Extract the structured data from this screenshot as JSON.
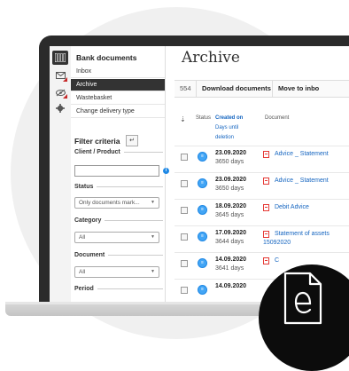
{
  "sidebar": {
    "title": "Bank documents",
    "items": [
      {
        "label": "Inbox",
        "active": false
      },
      {
        "label": "Archive",
        "active": true
      },
      {
        "label": "Wastebasket",
        "active": false
      },
      {
        "label": "Change delivery type",
        "active": false
      }
    ],
    "filter": {
      "title": "Filter criteria",
      "client_label": "Client / Product",
      "client_value": "",
      "status_label": "Status",
      "status_value": "Only documents mark...",
      "category_label": "Category",
      "category_value": "All",
      "document_label": "Document",
      "document_value": "All",
      "period_label": "Period"
    }
  },
  "main": {
    "title": "Archive",
    "toolbar": {
      "count": "554",
      "download_label": "Download documents",
      "move_label": "Move to inbo"
    },
    "columns": {
      "status": "Status",
      "created_on": "Created on",
      "days_line1": "Days until",
      "days_line2": "deletion",
      "document": "Document"
    },
    "rows": [
      {
        "date": "23.09.2020",
        "days": "3650 days",
        "doc": "Advice _ Statement",
        "doc2": ""
      },
      {
        "date": "23.09.2020",
        "days": "3650 days",
        "doc": "Advice _ Statement",
        "doc2": ""
      },
      {
        "date": "18.09.2020",
        "days": "3645 days",
        "doc": "Debit Advice",
        "doc2": ""
      },
      {
        "date": "17.09.2020",
        "days": "3644 days",
        "doc": "Statement of assets",
        "doc2": "15092020"
      },
      {
        "date": "14.09.2020",
        "days": "3641 days",
        "doc": "C",
        "doc2": ""
      },
      {
        "date": "14.09.2020",
        "days": "",
        "doc": "",
        "doc2": ""
      }
    ]
  },
  "colors": {
    "accent_blue": "#1565c0",
    "status_icon": "#42a5f5",
    "active_nav": "#333333",
    "pdf_red": "#e53935",
    "badge": "#0c0c0c"
  },
  "icons": [
    "grid-icon",
    "mail-icon",
    "eye-off-icon",
    "gear-icon",
    "info-icon",
    "pdf-icon",
    "document-e-icon"
  ]
}
